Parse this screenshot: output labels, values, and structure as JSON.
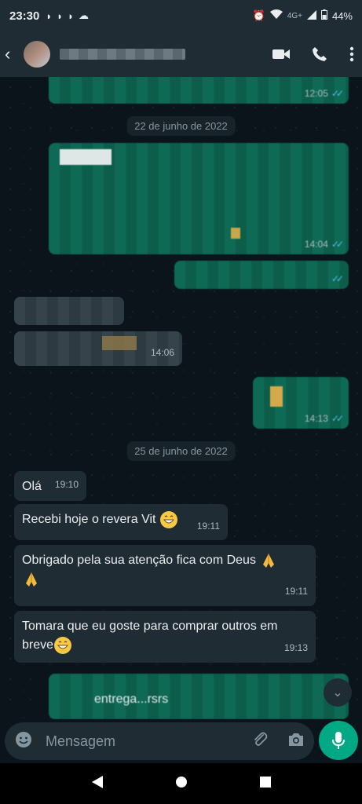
{
  "status_bar": {
    "time": "23:30",
    "network": "4G+",
    "battery": "44%"
  },
  "app_bar": {
    "icons": [
      "back-arrow-icon",
      "video-call-icon",
      "phone-icon",
      "more-vertical-icon"
    ]
  },
  "messages": {
    "first_partial_time": "12:05",
    "date_1": "22 de junho de 2022",
    "out_long_time": "14:04",
    "in_ok_time": "14:06",
    "out_img_time": "14:13",
    "date_2": "25 de junho de 2022",
    "in_1": {
      "text": "Olá",
      "time": "19:10"
    },
    "in_2": {
      "text": "Recebi hoje o revera Vit",
      "time": "19:11"
    },
    "in_3": {
      "text": "Obrigado pela sua atenção  fica com Deus",
      "time": "19:11"
    },
    "in_4": {
      "text_line1": "Tomara que eu goste para comprar outros em",
      "text_line2": "breve",
      "time": "19:13"
    },
    "last_out_partial": "entrega...rsrs"
  },
  "input": {
    "placeholder": "Mensagem"
  },
  "colors": {
    "accent": "#00a884",
    "outgoing": "#005c4b",
    "incoming": "#202c33",
    "tick": "#53bdeb"
  }
}
